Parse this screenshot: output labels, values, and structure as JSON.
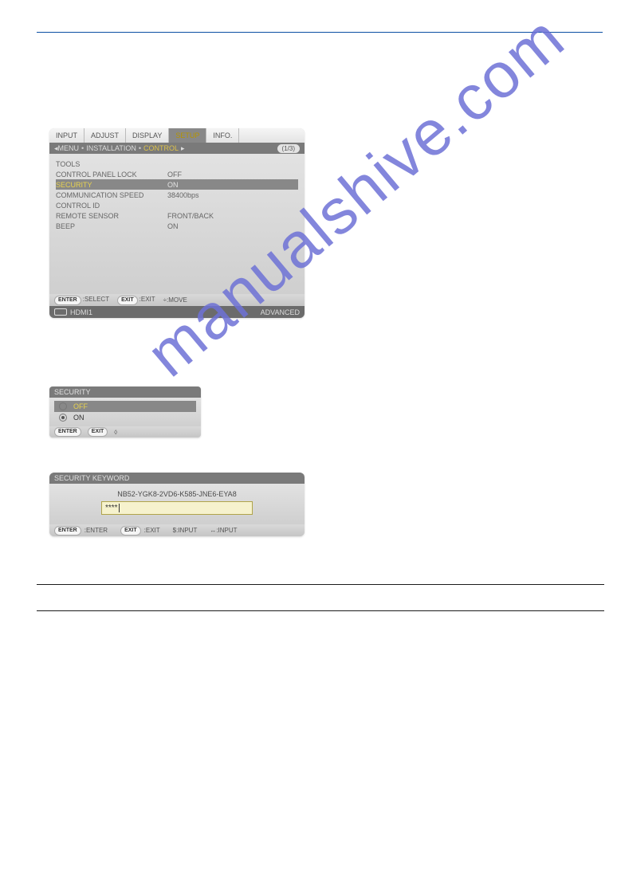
{
  "watermark": "manualshive.com",
  "main_menu": {
    "tabs": [
      "INPUT",
      "ADJUST",
      "DISPLAY",
      "SETUP",
      "INFO."
    ],
    "active_tab_index": 3,
    "breadcrumb": [
      "MENU",
      "INSTALLATION",
      "CONTROL"
    ],
    "breadcrumb_arrow": "▸",
    "page_indicator": "(1/3)",
    "rows": [
      {
        "label": "TOOLS",
        "value": ""
      },
      {
        "label": "CONTROL PANEL LOCK",
        "value": "OFF"
      },
      {
        "label": "SECURITY",
        "value": "ON",
        "highlight": true
      },
      {
        "label": "COMMUNICATION SPEED",
        "value": "38400bps"
      },
      {
        "label": "CONTROL ID",
        "value": ""
      },
      {
        "label": "REMOTE SENSOR",
        "value": "FRONT/BACK"
      },
      {
        "label": "BEEP",
        "value": "ON"
      }
    ],
    "footer": {
      "enter_pill": "ENTER",
      "enter_label": ":SELECT",
      "exit_pill": "EXIT",
      "exit_label": ":EXIT",
      "move_label": "÷:MOVE"
    },
    "status": {
      "port_icon_name": "hdmi-icon",
      "port": "HDMI1",
      "mode": "ADVANCED"
    }
  },
  "security_panel": {
    "title": "SECURITY",
    "options": [
      {
        "label": "OFF",
        "selected": false,
        "highlight": true
      },
      {
        "label": "ON",
        "selected": true,
        "highlight": false
      }
    ],
    "footer": {
      "enter_pill": "ENTER",
      "exit_pill": "EXIT",
      "updown": "◊"
    }
  },
  "keyword_panel": {
    "title": "SECURITY KEYWORD",
    "keycode": "NB52-YGK8-2VD6-K585-JNE6-EYA8",
    "input_value": "****",
    "footer": {
      "enter_pill": "ENTER",
      "enter_label": ":ENTER",
      "exit_pill": "EXIT",
      "exit_label": ":EXIT",
      "input1": "$:INPUT",
      "input2": "↔:INPUT"
    }
  }
}
